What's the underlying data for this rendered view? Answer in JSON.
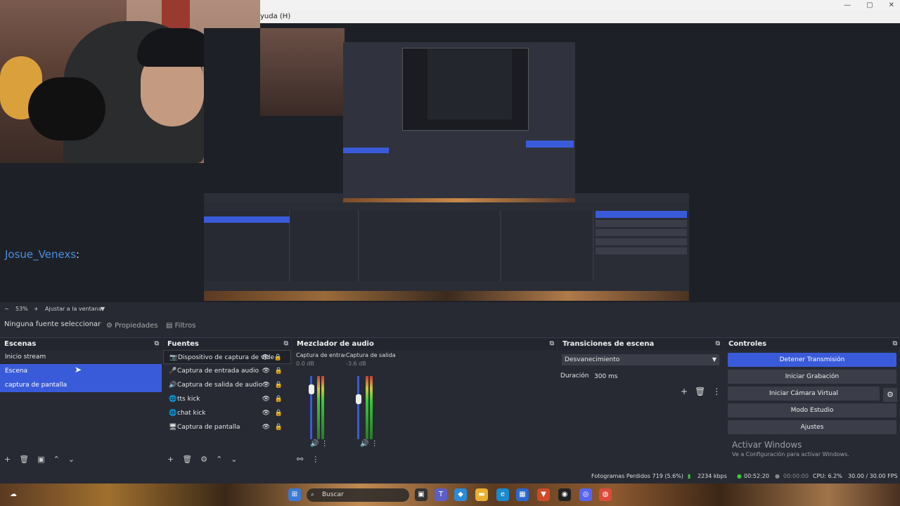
{
  "window": {
    "menu_text": "yuda (H)",
    "minimize": "—",
    "maximize": "▢",
    "close": "✕"
  },
  "chat": {
    "username": "Josue_Venexs",
    "colon": ":"
  },
  "zoom": {
    "minus": "−",
    "percent": "53%",
    "plus": "+",
    "fit_label": "Ajustar a la ventana",
    "dropdown": "▼"
  },
  "source_bar": {
    "no_selection": "Ninguna fuente seleccionar",
    "properties": "Propiedades",
    "filters": "Filtros"
  },
  "scenes": {
    "title": "Escenas",
    "items": [
      "Inicio stream",
      "Escena",
      "captura de pantalla"
    ]
  },
  "sources": {
    "title": "Fuentes",
    "items": [
      {
        "icon": "camera-icon",
        "glyph": "📷",
        "label": "Dispositivo de captura de vide"
      },
      {
        "icon": "mic-icon",
        "glyph": "🎤",
        "label": "Captura de entrada audio"
      },
      {
        "icon": "speaker-icon",
        "glyph": "🔊",
        "label": "Captura de salida de audio"
      },
      {
        "icon": "browser-icon",
        "glyph": "🌐",
        "label": "tts kick"
      },
      {
        "icon": "browser-icon",
        "glyph": "🌐",
        "label": "chat kick"
      },
      {
        "icon": "monitor-icon",
        "glyph": "🖥",
        "label": "Captura de pantalla"
      }
    ]
  },
  "mixer": {
    "title": "Mezclador de audio",
    "channels": [
      {
        "name": "Captura de entrada",
        "db": "0.0 dB",
        "level": 0.9
      },
      {
        "name": "Captura de salida c",
        "db": "-3.6 dB",
        "level": 0.75
      }
    ]
  },
  "transitions": {
    "title": "Transiciones de escena",
    "selected": "Desvanecimiento",
    "duration_label": "Duración",
    "duration_value": "300 ms"
  },
  "controls": {
    "title": "Controles",
    "stop_stream": "Detener Transmisión",
    "start_recording": "Iniciar Grabación",
    "virtual_cam": "Iniciar Cámara Virtual",
    "studio_mode": "Modo Estudio",
    "settings": "Ajustes"
  },
  "activate_windows": {
    "title": "Activar Windows",
    "subtitle": "Ve a Configuración para activar Windows."
  },
  "status": {
    "dropped_frames": "Fotogramas Perdidos 719 (5.6%)",
    "bitrate": "2234 kbps",
    "stream_time": "00:52:20",
    "rec_time": "00:00:00",
    "cpu": "CPU: 6.2%",
    "fps": "30.00 / 30.00 FPS"
  },
  "taskbar": {
    "search_placeholder": "Buscar"
  },
  "colors": {
    "accent": "#3a5bd9",
    "panel": "#272a33",
    "chat_name": "#4a90e2"
  }
}
